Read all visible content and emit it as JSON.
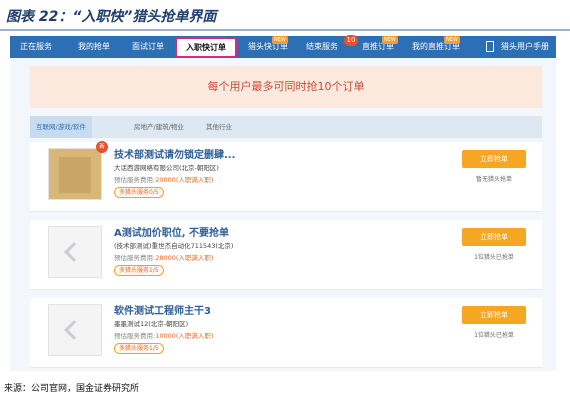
{
  "figure_title": "图表 22：“入职快”猎头抢单界面",
  "source": "来源：公司官网，国金证券研究所",
  "nav": {
    "items": [
      {
        "label": "正在服务"
      },
      {
        "label": "我的抢单"
      },
      {
        "label": "面试订单"
      },
      {
        "label": "入职快订单"
      },
      {
        "label": "猎头快订单"
      },
      {
        "label": "结束服务"
      },
      {
        "label": "直推订单"
      },
      {
        "label": "我的直推订单"
      },
      {
        "label": "猎头用户手册"
      }
    ],
    "badge_count": "10",
    "tag": "NEW"
  },
  "notice": "每个用户最多可同时抢10个订单",
  "subtabs": [
    "互联网/游戏/软件",
    "房地产/建筑/物业",
    "其他行业"
  ],
  "cards": [
    {
      "badge": "新",
      "title": "技术部测试请勿锁定删肆...",
      "company": "大话西游网络有限公司(北京-朝阳区)",
      "fee_label": "预估服务费用:",
      "fee_value": "20000(入职满入职)",
      "pill": "多猎头服务0/5",
      "button": "立即抢单",
      "status": "暂无猎头抢单"
    },
    {
      "badge": "",
      "title": "A测试加价职位, 不要抢单",
      "company": "(技术部测试)重世杰自动化711543(北京)",
      "fee_label": "预估服务费用:",
      "fee_value": "28000(入职满入职)",
      "pill": "多猎头服务1/5",
      "button": "立即抢单",
      "status": "1位猎头已抢单"
    },
    {
      "badge": "",
      "title": "软件测试工程师主干3",
      "company": "墨墨测试12(北京-朝阳区)",
      "fee_label": "预估服务费用:",
      "fee_value": "10000(入职满入职)",
      "pill": "多猎头服务1/5",
      "button": "立即抢单",
      "status": "1位猎头已抢单"
    }
  ]
}
